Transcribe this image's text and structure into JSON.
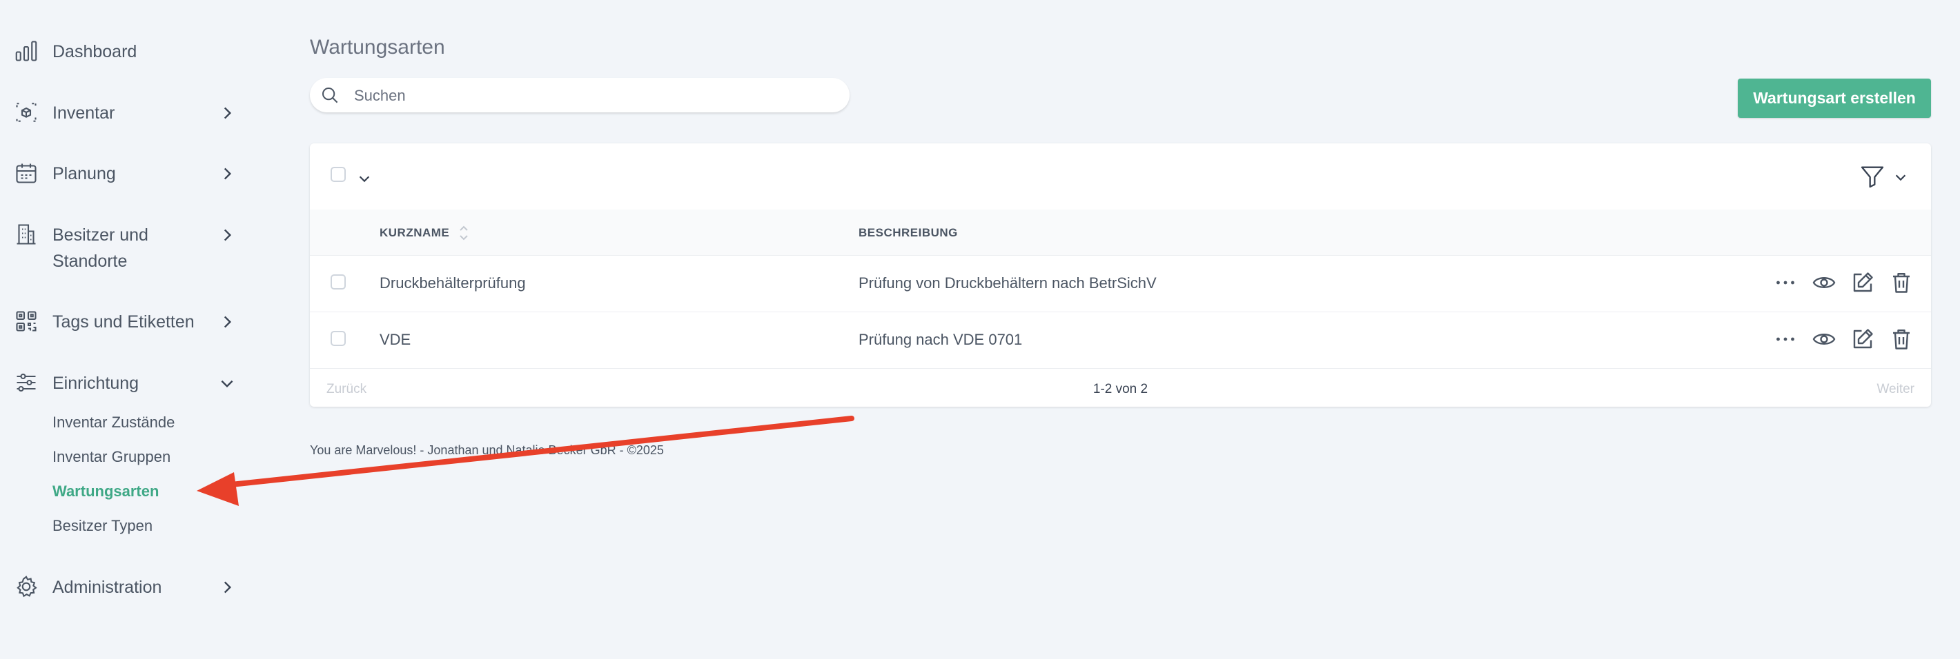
{
  "sidebar": {
    "items": [
      {
        "label": "Dashboard",
        "icon": "bar-chart-icon"
      },
      {
        "label": "Inventar",
        "icon": "cube-scan-icon"
      },
      {
        "label": "Planung",
        "icon": "calendar-icon"
      },
      {
        "label_line1": "Besitzer und",
        "label_line2": "Standorte",
        "icon": "building-icon"
      },
      {
        "label": "Tags und Etiketten",
        "icon": "qr-code-icon"
      },
      {
        "label": "Einrichtung",
        "icon": "sliders-icon",
        "expanded": true
      },
      {
        "label": "Administration",
        "icon": "gear-icon"
      }
    ],
    "sub_items": [
      {
        "label": "Inventar Zustände"
      },
      {
        "label": "Inventar Gruppen"
      },
      {
        "label": "Wartungsarten",
        "active": true
      },
      {
        "label": "Besitzer Typen"
      }
    ],
    "active_color": "#3fa886"
  },
  "main": {
    "title": "Wartungsarten",
    "search": {
      "placeholder": "Suchen",
      "value": ""
    },
    "create_button": "Wartungsart erstellen",
    "accent_color": "#4fb592",
    "table": {
      "columns": [
        "KURZNAME",
        "BESCHREIBUNG"
      ],
      "rows": [
        {
          "kurzname": "Druckbehälterprüfung",
          "beschreibung": "Prüfung von Druckbehältern nach BetrSichV"
        },
        {
          "kurzname": "VDE",
          "beschreibung": "Prüfung nach VDE 0701"
        }
      ],
      "row_actions": [
        "more-icon",
        "eye-icon",
        "edit-icon",
        "trash-icon"
      ]
    },
    "pagination": {
      "prev": "Zurück",
      "info": "1-2 von 2",
      "next": "Weiter"
    },
    "footer": "You are Marvelous! - Jonathan und Natalie Becker GbR - ©2025"
  },
  "annotation": {
    "color": "#e8402a"
  }
}
